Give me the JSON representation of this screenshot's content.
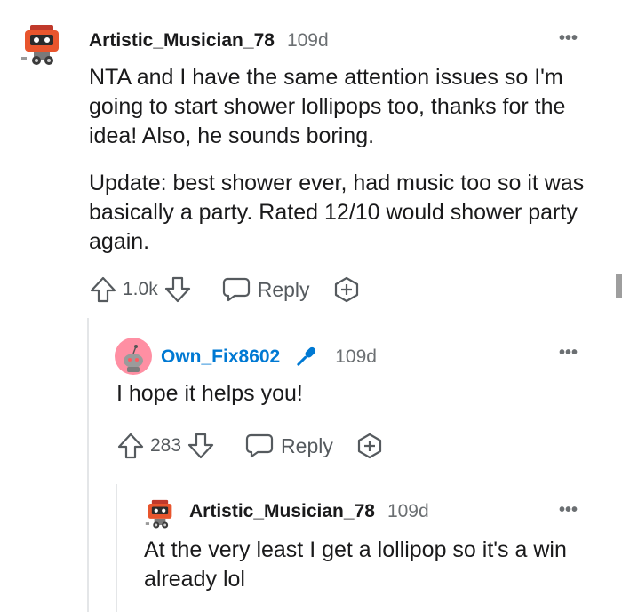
{
  "comments": [
    {
      "username": "Artistic_Musician_78",
      "age": "109d",
      "paragraphs": [
        "NTA and I have the same attention issues so I'm going to start shower lollipops too, thanks for the idea! Also, he sounds boring.",
        "Update: best shower ever, had music too so it was basically a party. Rated 12/10 would shower party again."
      ],
      "votes": "1.0k",
      "reply_label": "Reply",
      "avatar_icon": "robot-avatar-icon"
    },
    {
      "username": "Own_Fix8602",
      "age": "109d",
      "paragraphs": [
        "I hope it helps you!"
      ],
      "votes": "283",
      "reply_label": "Reply",
      "avatar_icon": "snoo-avatar-icon",
      "flair_icon": "microphone-icon"
    },
    {
      "username": "Artistic_Musician_78",
      "age": "109d",
      "paragraphs": [
        "At the very least I get a lollipop so it's a win already lol"
      ],
      "avatar_icon": "robot-avatar-icon"
    }
  ],
  "colors": {
    "text": "#1a1a1b",
    "meta": "#6b6f72",
    "username_blue": "#0079d3",
    "thread_line": "#e4e6e8",
    "avatar_pink": "#ff8fa3"
  }
}
